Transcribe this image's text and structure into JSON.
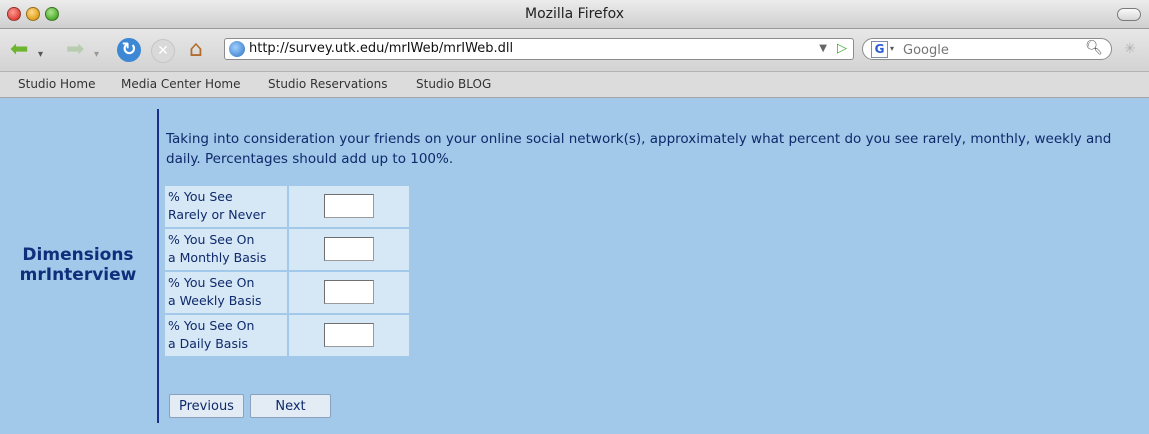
{
  "window": {
    "title": "Mozilla Firefox"
  },
  "toolbar": {
    "url": "http://survey.utk.edu/mrIWeb/mrIWeb.dll",
    "search_placeholder": "Google"
  },
  "bookmarks": [
    "Studio Home",
    "Media Center Home",
    "Studio Reservations",
    "Studio BLOG"
  ],
  "sidebar": {
    "brand_line1": "Dimensions",
    "brand_line2": "mrInterview"
  },
  "question": {
    "text": "Taking into consideration your friends on your online social network(s), approximately what percent do you see rarely, monthly, weekly and daily. Percentages should add up to 100%."
  },
  "rows": [
    {
      "line1": "% You See",
      "line2": "Rarely or Never",
      "value": ""
    },
    {
      "line1": "% You See On",
      "line2": "a Monthly Basis",
      "value": ""
    },
    {
      "line1": "% You See On",
      "line2": "a Weekly Basis",
      "value": ""
    },
    {
      "line1": "% You See On",
      "line2": "a Daily Basis",
      "value": ""
    }
  ],
  "buttons": {
    "previous": "Previous",
    "next": "Next"
  },
  "colors": {
    "page_bg": "#a2c8ea",
    "cell_bg": "#d6e7f6",
    "text": "#0e2a6a",
    "divider": "#1a2f8a"
  }
}
